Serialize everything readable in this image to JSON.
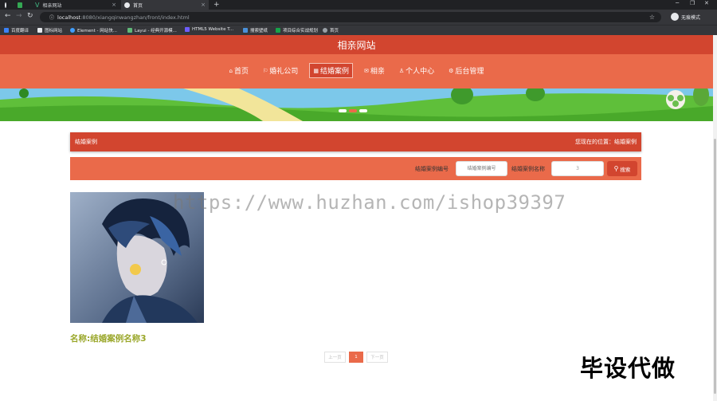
{
  "browser": {
    "tabs": [
      {
        "label": ""
      },
      {
        "label": "相亲网站"
      },
      {
        "label": "首页"
      }
    ],
    "new_tab": "+",
    "url_host": "localhost",
    "url_path": ":8080/xiangqinwangzhan/front/index.html",
    "guest_label": "无痕模式",
    "bookmarks": [
      {
        "label": "百度翻译",
        "color": "#3b82f6"
      },
      {
        "label": "图标网站",
        "color": "#111111"
      },
      {
        "label": "Element - 网站快...",
        "color": "#409eff"
      },
      {
        "label": "Layui - 经典开源模...",
        "color": "#5fb878"
      },
      {
        "label": "HTML5 Website T...",
        "color": "#6d5dfc"
      },
      {
        "label": "搜索壁纸",
        "color": "#4a90d9"
      },
      {
        "label": "项目综合实战规划",
        "color": "#16a34a"
      },
      {
        "label": "首页",
        "color": "#9aa0a6"
      }
    ]
  },
  "site": {
    "title": "相亲网站",
    "nav": [
      {
        "icon": "⌂",
        "label": "首页",
        "active": false
      },
      {
        "icon": "⚐",
        "label": "婚礼公司",
        "active": false
      },
      {
        "icon": "▦",
        "label": "结婚案例",
        "active": true
      },
      {
        "icon": "✉",
        "label": "相亲",
        "active": false
      },
      {
        "icon": "♙",
        "label": "个人中心",
        "active": false
      },
      {
        "icon": "⚙",
        "label": "后台管理",
        "active": false
      }
    ]
  },
  "breadcrumb": {
    "left": "结婚案例",
    "right": "您现在的位置：结婚案例"
  },
  "search": {
    "field1_label": "结婚案例编号",
    "field1_placeholder": "结婚案例编号",
    "field2_label": "结婚案例名称",
    "field2_value": "3",
    "button_label": "搜索"
  },
  "cases": [
    {
      "name": "名称:结婚案例名称3"
    }
  ],
  "pager": {
    "prev": "上一页",
    "current": "1",
    "next": "下一页"
  },
  "overlay": {
    "watermark": "https://www.huzhan.com/ishop39397",
    "sticker": "毕设代做"
  },
  "colors": {
    "accent": "#ea6a4a",
    "accent_dark": "#d2452f",
    "case_name": "#9aa72a"
  }
}
